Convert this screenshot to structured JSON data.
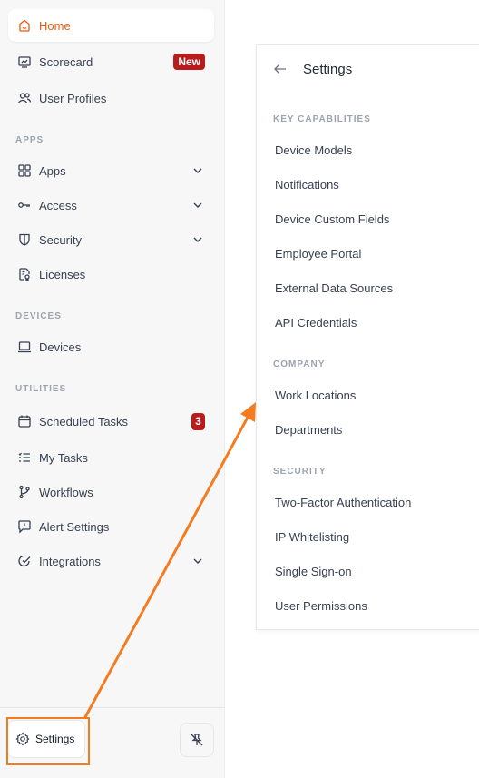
{
  "sidebar": {
    "items": [
      {
        "label": "Home"
      },
      {
        "label": "Scorecard",
        "badge": "New"
      },
      {
        "label": "User Profiles"
      }
    ],
    "sections": {
      "apps": "APPS",
      "devices": "DEVICES",
      "utilities": "UTILITIES"
    },
    "apps_items": [
      {
        "label": "Apps"
      },
      {
        "label": "Access"
      },
      {
        "label": "Security"
      },
      {
        "label": "Licenses"
      }
    ],
    "devices_items": [
      {
        "label": "Devices"
      }
    ],
    "utilities_items": [
      {
        "label": "Scheduled Tasks",
        "badge": "3"
      },
      {
        "label": "My Tasks"
      },
      {
        "label": "Workflows"
      },
      {
        "label": "Alert Settings"
      },
      {
        "label": "Integrations"
      }
    ],
    "footer": {
      "settings_label": "Settings"
    }
  },
  "panel": {
    "title": "Settings",
    "sections": [
      {
        "title": "KEY CAPABILITIES",
        "items": [
          "Device Models",
          "Notifications",
          "Device Custom Fields",
          "Employee Portal",
          "External Data Sources",
          "API Credentials"
        ]
      },
      {
        "title": "COMPANY",
        "items": [
          "Work Locations",
          "Departments"
        ]
      },
      {
        "title": "SECURITY",
        "items": [
          "Two-Factor Authentication",
          "IP Whitelisting",
          "Single Sign-on",
          "User Permissions"
        ]
      }
    ]
  },
  "colors": {
    "accent": "#ea580c",
    "badge": "#b91c1c",
    "annotation": "#f47c20"
  }
}
